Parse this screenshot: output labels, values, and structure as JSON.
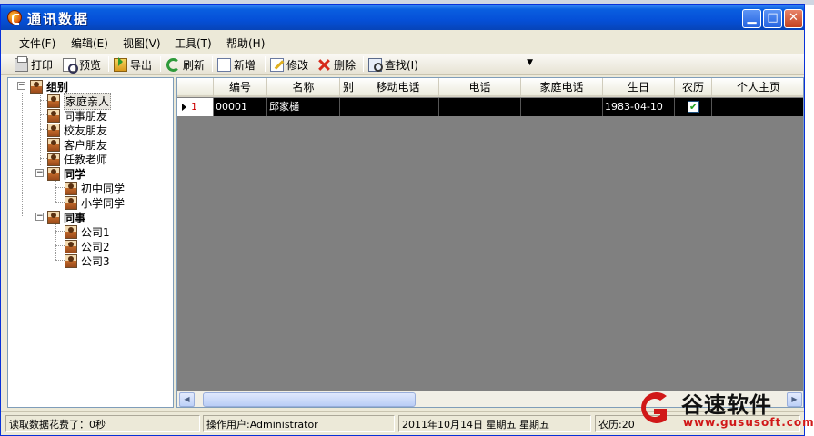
{
  "window": {
    "title": "通讯数据"
  },
  "titlebar_buttons": {
    "minimize": "▁",
    "maximize": "□",
    "close": "✕"
  },
  "menu": [
    "文件(F)",
    "编辑(E)",
    "视图(V)",
    "工具(T)",
    "帮助(H)"
  ],
  "toolbar": {
    "print": "打印",
    "preview": "预览",
    "export": "导出",
    "refresh": "刷新",
    "new": "新增",
    "edit": "修改",
    "delete": "删除",
    "find": "查找(I)",
    "combo_value": ""
  },
  "tree": {
    "root": "组别",
    "groups": [
      {
        "label": "家庭亲人",
        "selected": true
      },
      {
        "label": "同事朋友"
      },
      {
        "label": "校友朋友"
      },
      {
        "label": "客户朋友"
      },
      {
        "label": "任教老师"
      }
    ],
    "classmates": {
      "label": "同学",
      "children": [
        "初中同学",
        "小学同学"
      ]
    },
    "colleagues": {
      "label": "同事",
      "children": [
        "公司1",
        "公司2",
        "公司3"
      ]
    }
  },
  "grid": {
    "columns": [
      "编号",
      "名称",
      "别",
      "移动电话",
      "电话",
      "家庭电话",
      "生日",
      "农历",
      "个人主页"
    ],
    "rows": [
      {
        "index": "1",
        "id": "00001",
        "name": "邱家樋",
        "gender": "",
        "mobile": "",
        "phone": "",
        "home_phone": "",
        "birthday": "1983-04-10",
        "lunar": true,
        "homepage": ""
      }
    ]
  },
  "scrollbar": {
    "left": "◀",
    "right": "▶"
  },
  "statusbar": {
    "load_time": "读取数据花费了：0秒",
    "user": "操作用户:Administrator",
    "date": "2011年10月14日 星期五  星期五",
    "lunar": "农历:20"
  },
  "watermark": {
    "brand": "谷速软件",
    "url": "www.gususoft.com"
  },
  "colors": {
    "titlebar": "#0550d8",
    "grid_bg": "#808080",
    "row_selected": "#000000",
    "watermark_red": "#d01818"
  }
}
